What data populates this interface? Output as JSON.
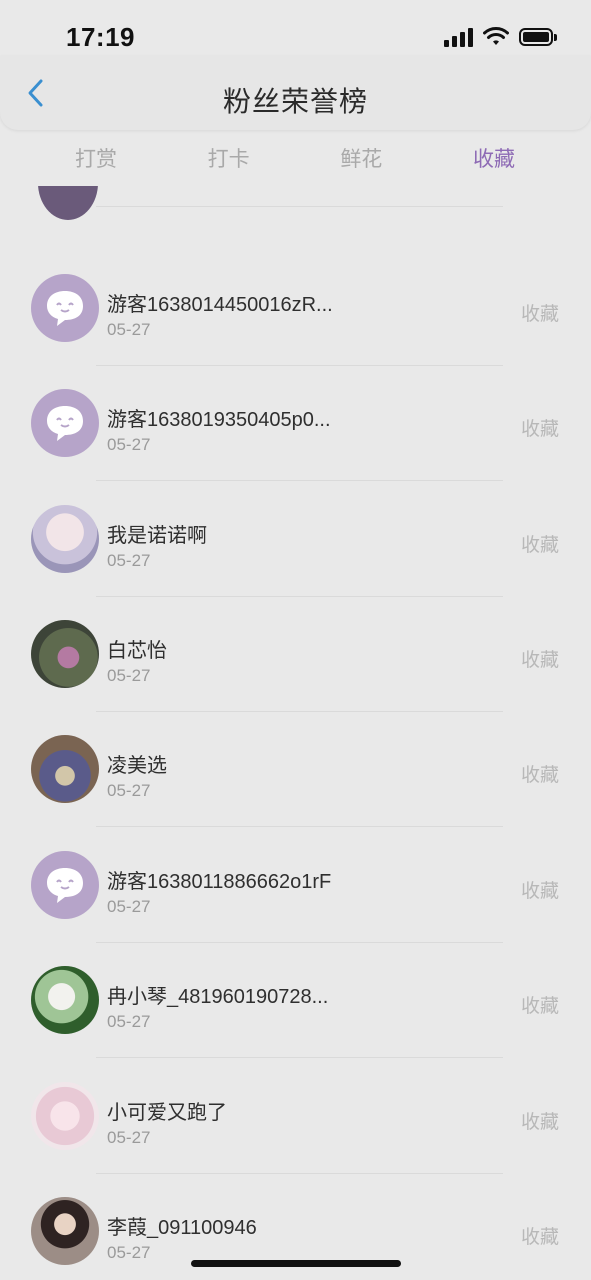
{
  "status_bar": {
    "time": "17:19"
  },
  "header": {
    "title": "粉丝荣誉榜"
  },
  "tabs": [
    {
      "label": "打赏",
      "active": false
    },
    {
      "label": "打卡",
      "active": false
    },
    {
      "label": "鲜花",
      "active": false
    },
    {
      "label": "收藏",
      "active": true
    }
  ],
  "colors": {
    "accent": "#8e6bb5",
    "guest_avatar": "#b6a4c9",
    "muted_text": "#9a9a9a"
  },
  "list": {
    "items": [
      {
        "name": "游客1638014450016zR...",
        "date": "05-27",
        "action": "收藏",
        "avatar": "guest-chat-icon"
      },
      {
        "name": "游客1638019350405p0...",
        "date": "05-27",
        "action": "收藏",
        "avatar": "guest-chat-icon"
      },
      {
        "name": "我是诺诺啊",
        "date": "05-27",
        "action": "收藏",
        "avatar": "user-photo"
      },
      {
        "name": "白芯怡",
        "date": "05-27",
        "action": "收藏",
        "avatar": "user-photo"
      },
      {
        "name": "凌美选",
        "date": "05-27",
        "action": "收藏",
        "avatar": "user-photo"
      },
      {
        "name": "游客1638011886662o1rF",
        "date": "05-27",
        "action": "收藏",
        "avatar": "guest-chat-icon"
      },
      {
        "name": "冉小琴_481960190728...",
        "date": "05-27",
        "action": "收藏",
        "avatar": "user-photo"
      },
      {
        "name": "小可爱又跑了",
        "date": "05-27",
        "action": "收藏",
        "avatar": "user-photo"
      },
      {
        "name": "李葭_091100946",
        "date": "05-27",
        "action": "收藏",
        "avatar": "user-photo"
      }
    ]
  }
}
